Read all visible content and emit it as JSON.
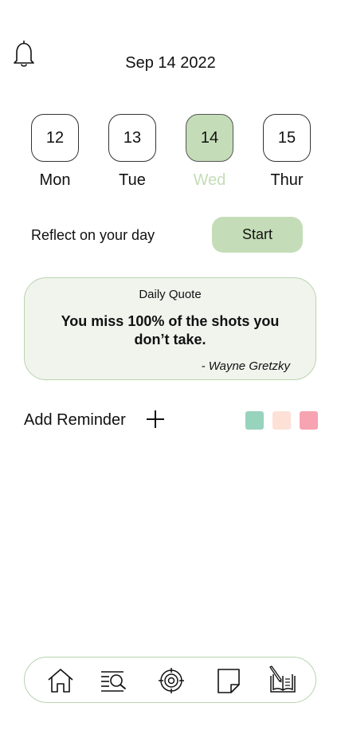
{
  "header": {
    "date": "Sep 14 2022",
    "bell_icon": "bell-icon"
  },
  "days": [
    {
      "num": "12",
      "label": "Mon",
      "selected": false
    },
    {
      "num": "13",
      "label": "Tue",
      "selected": false
    },
    {
      "num": "14",
      "label": "Wed",
      "selected": true
    },
    {
      "num": "15",
      "label": "Thur",
      "selected": false
    }
  ],
  "reflect": {
    "text": "Reflect on your day",
    "button": "Start"
  },
  "quote": {
    "heading": "Daily Quote",
    "text": "You miss 100% of the shots you don’t take.",
    "author": "- Wayne Gretzky"
  },
  "reminder": {
    "label": "Add Reminder",
    "add_icon": "plus-icon",
    "colors": [
      "#97d3bd",
      "#fde1d7",
      "#f7a3b2"
    ]
  },
  "nav": {
    "icons": [
      "home-icon",
      "search-list-icon",
      "target-icon",
      "note-icon",
      "journal-icon"
    ]
  },
  "colors": {
    "accent": "#c4ddb8",
    "card_bg": "#f0f4ed",
    "card_border": "#b9d3ad"
  }
}
